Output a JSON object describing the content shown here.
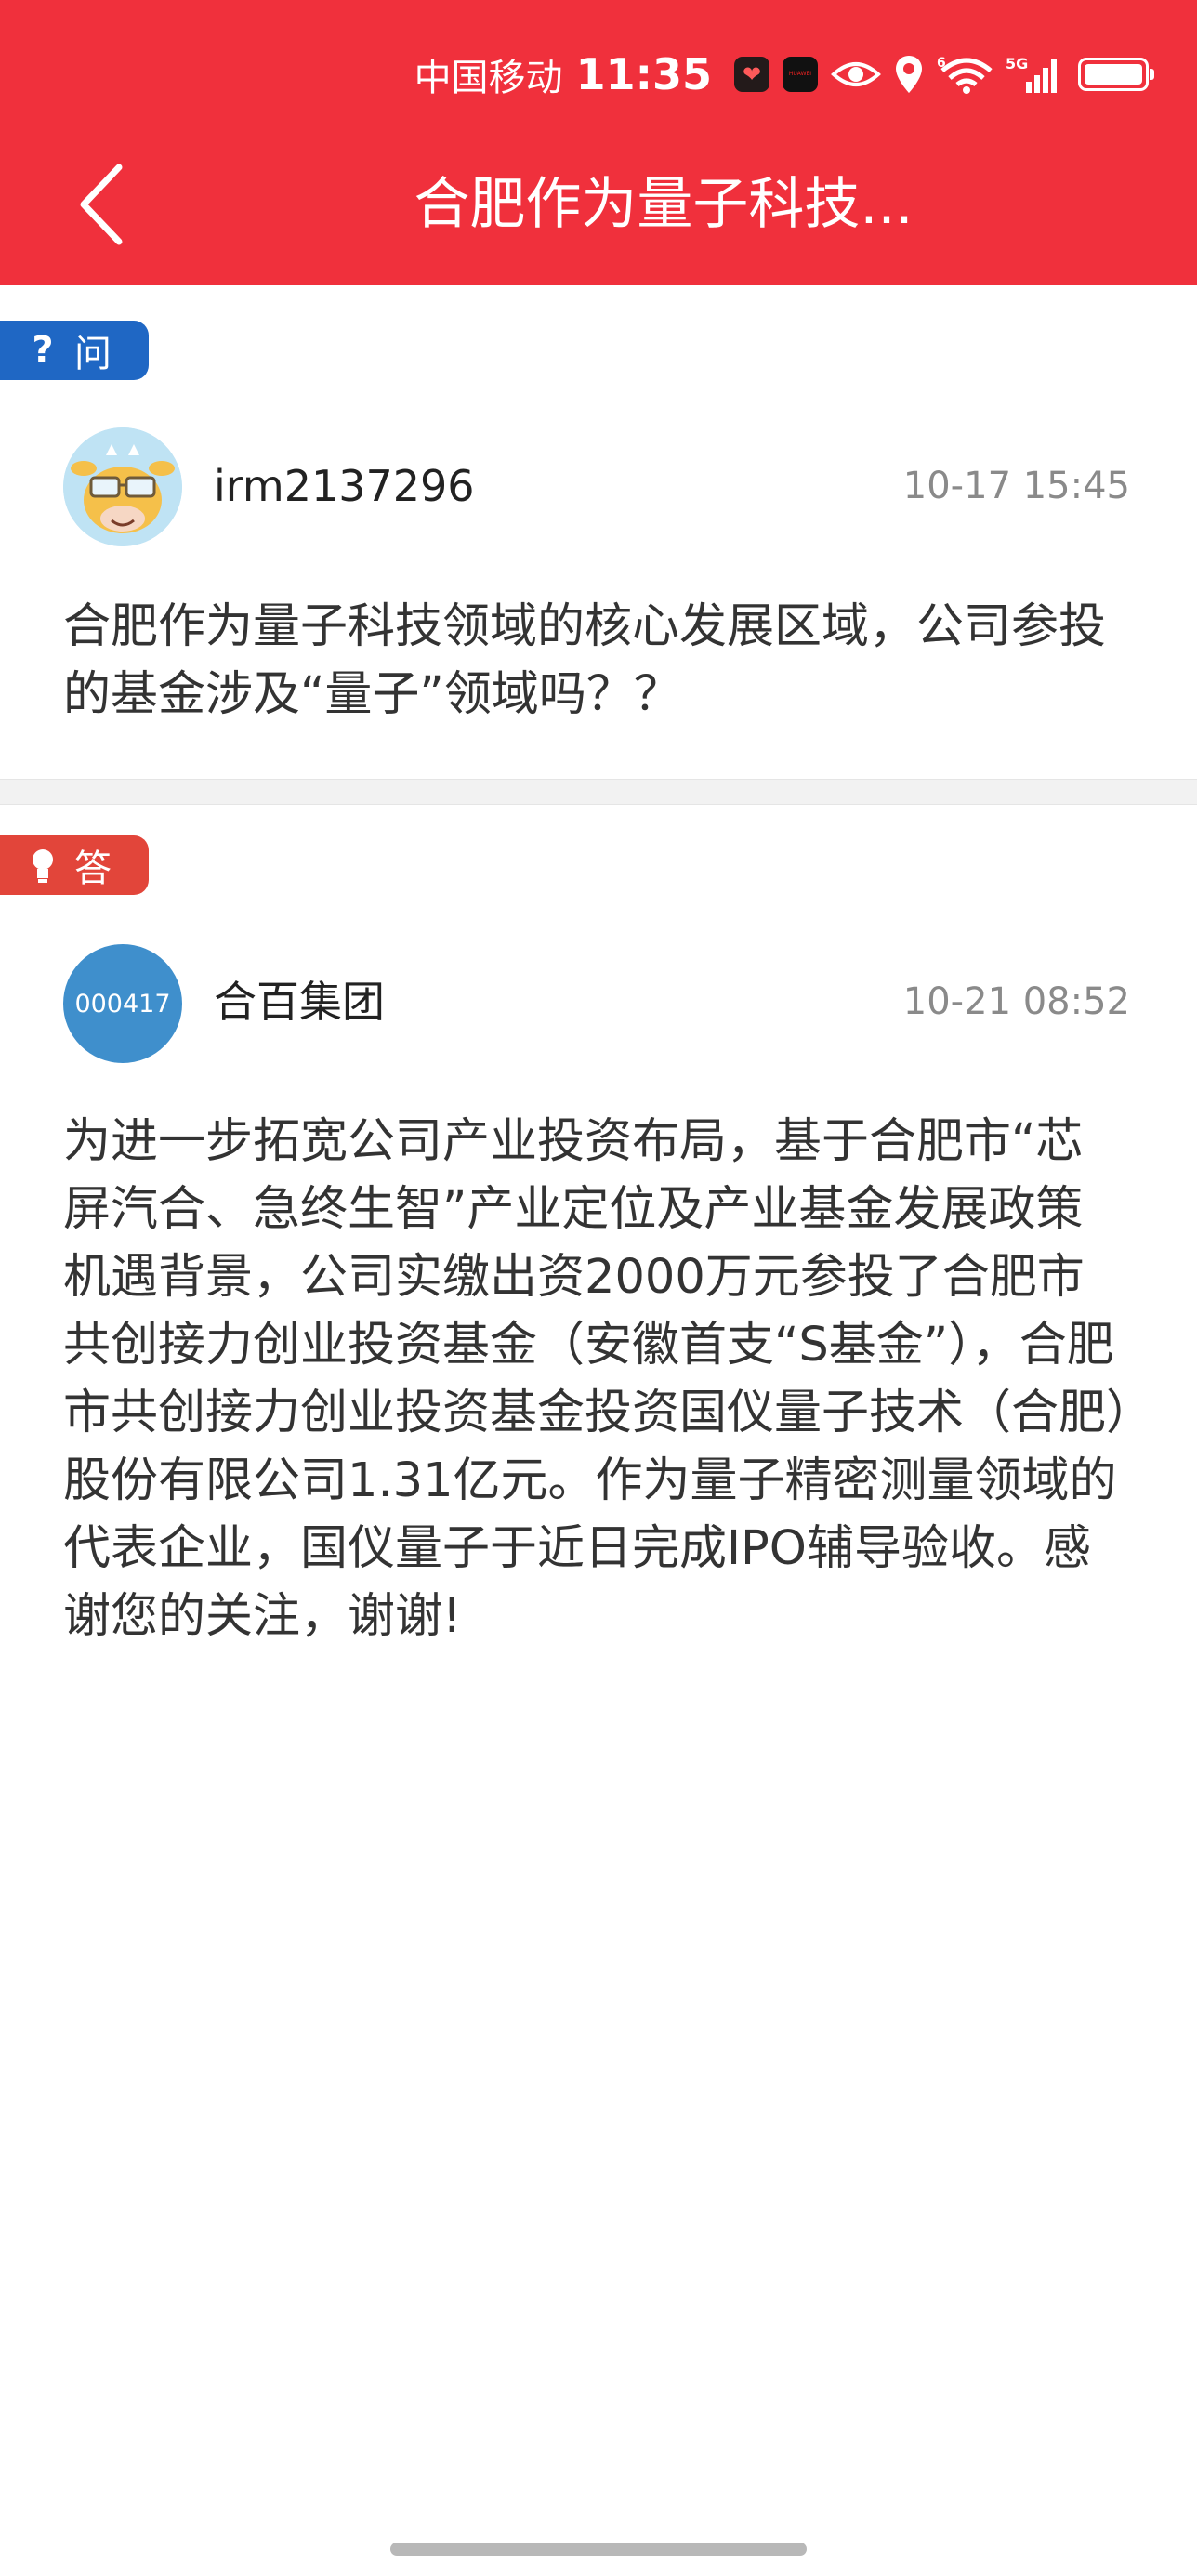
{
  "status_bar": {
    "carrier": "中国移动",
    "time": "11:35",
    "app_badge_1": "health-app-icon",
    "app_badge_2": "huawei-app-icon",
    "icons": [
      "eye-icon",
      "location-icon",
      "wifi-icon",
      "signal-5g-icon",
      "battery-charging-icon"
    ],
    "wifi_label": "6",
    "network_label": "5G",
    "battery_level": 1.0
  },
  "header": {
    "title": "合肥作为量子科技...",
    "background": "#f0303c"
  },
  "question": {
    "tag_label": "问",
    "tag_icon": "question-icon",
    "tag_color": "#1f67c4",
    "user": "irm2137296",
    "time": "10-17 15:45",
    "text": "合肥作为量子科技领域的核心发展区域，公司参投的基金涉及“量子”领域吗？？"
  },
  "answer": {
    "tag_label": "答",
    "tag_icon": "lightbulb-icon",
    "tag_color": "#e2453a",
    "avatar_text": "000417",
    "user": "合百集团",
    "time": "10-21 08:52",
    "text": "为进一步拓宽公司产业投资布局，基于合肥市“芯屏汽合、急终生智”产业定位及产业基金发展政策机遇背景，公司实缴出资2000万元参投了合肥市共创接力创业投资基金（安徽首支“S基金”），合肥市共创接力创业投资基金投资国仪量子技术（合肥）股份有限公司1.31亿元。作为量子精密测量领域的代表企业，国仪量子于近日完成IPO辅导验收。感谢您的关注，谢谢!"
  }
}
